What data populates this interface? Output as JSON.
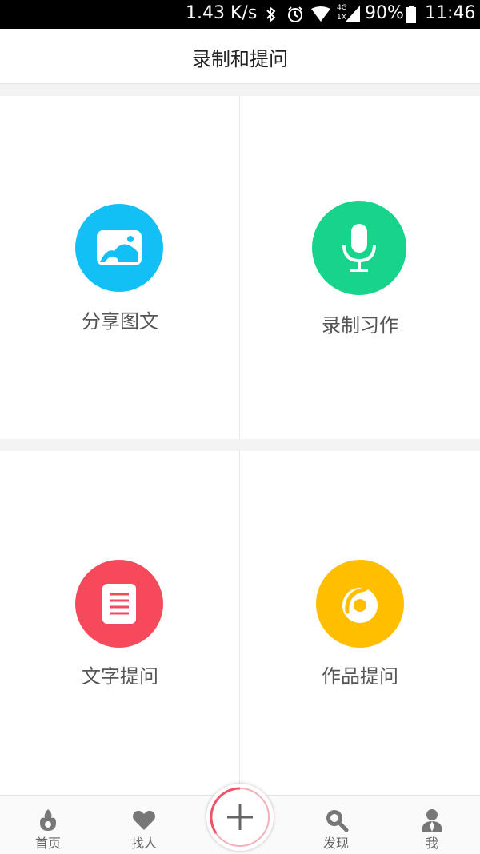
{
  "status_bar": {
    "speed": "1.43 K/s",
    "network": "4G",
    "network_sub": "1X",
    "battery": "90%",
    "time": "11:46"
  },
  "header": {
    "title": "录制和提问"
  },
  "grid": [
    {
      "label": "分享图文",
      "icon": "image-icon",
      "color": "#12C0F5"
    },
    {
      "label": "录制习作",
      "icon": "microphone-icon",
      "color": "#18D38A"
    },
    {
      "label": "文字提问",
      "icon": "document-icon",
      "color": "#F64A5C"
    },
    {
      "label": "作品提问",
      "icon": "pottery-icon",
      "color": "#FFBF00"
    }
  ],
  "tabbar": [
    {
      "label": "首页",
      "icon": "home-flame-icon"
    },
    {
      "label": "找人",
      "icon": "heart-icon"
    },
    {
      "label": "",
      "icon": "plus-icon"
    },
    {
      "label": "发现",
      "icon": "search-discover-icon"
    },
    {
      "label": "我",
      "icon": "user-icon"
    }
  ]
}
